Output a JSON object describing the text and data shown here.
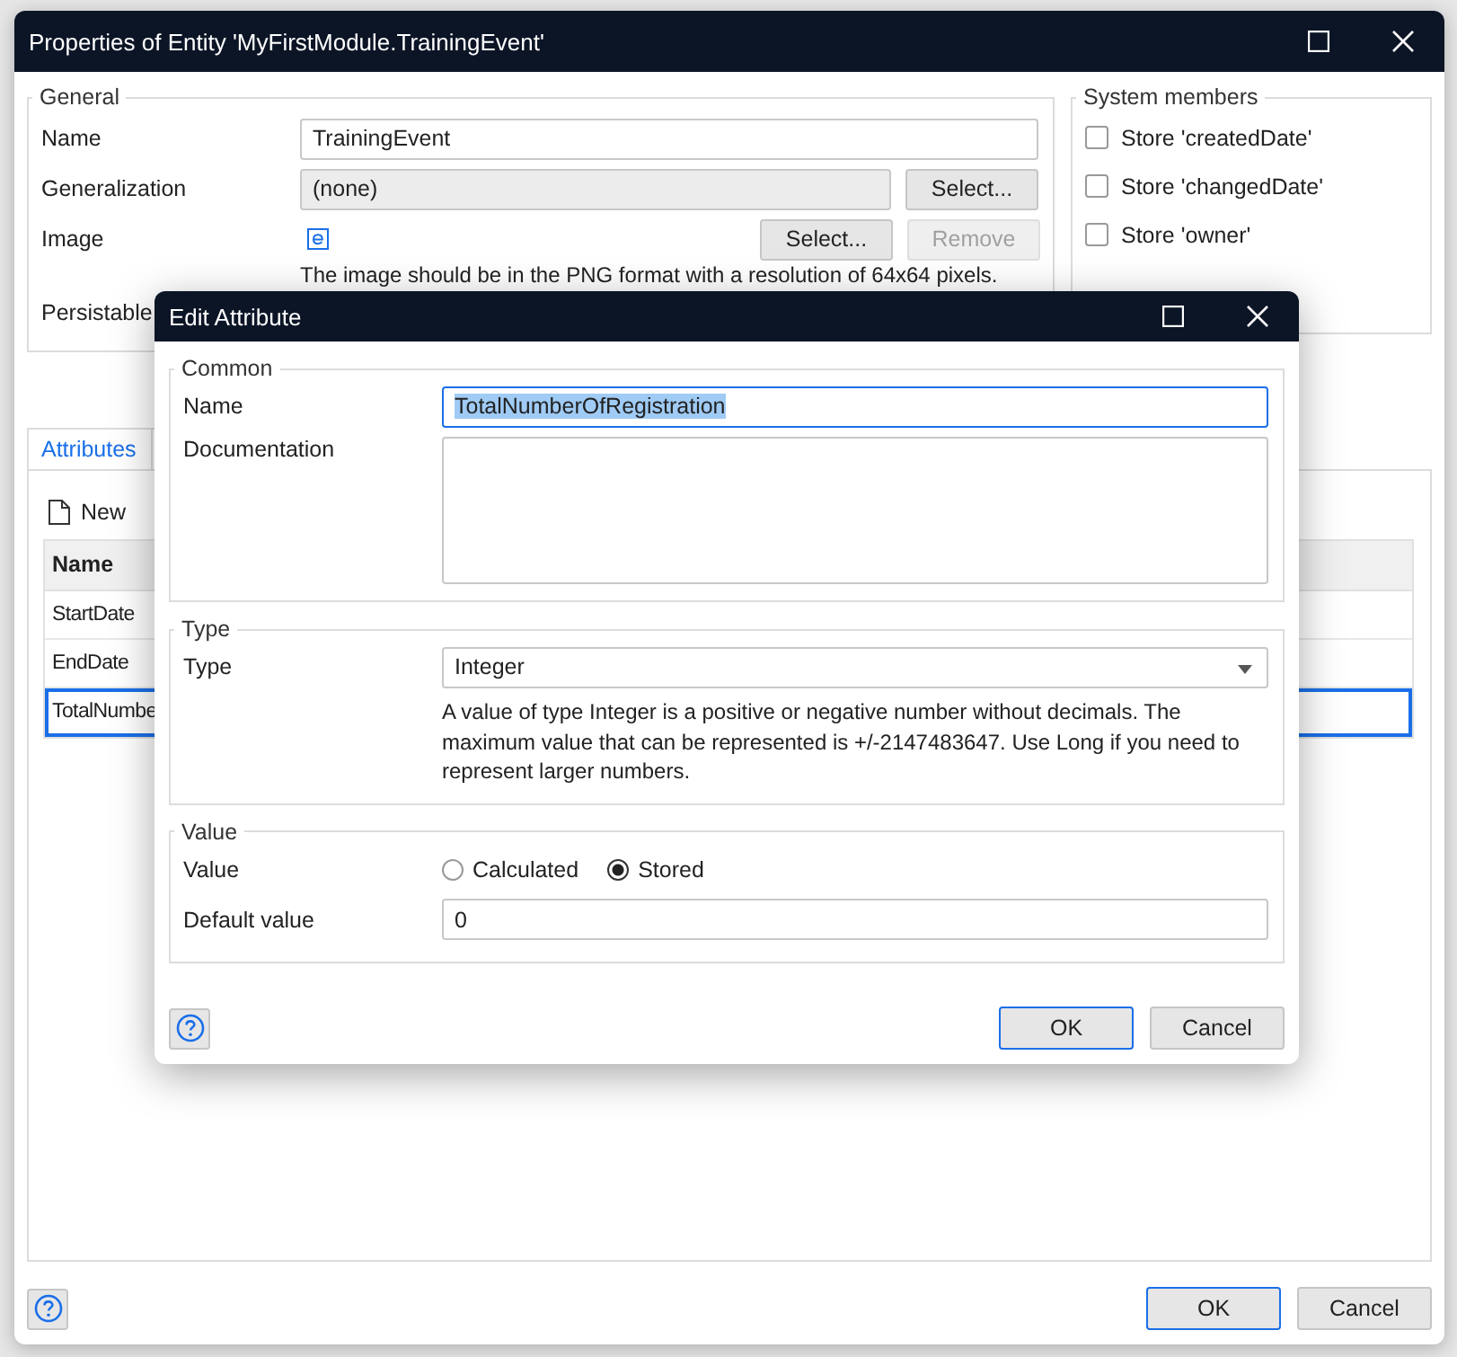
{
  "window": {
    "title": "Properties of Entity 'MyFirstModule.TrainingEvent'",
    "general": {
      "legend": "General",
      "name_field": {
        "label": "Name",
        "value": "TrainingEvent"
      },
      "generalization_field": {
        "label": "Generalization",
        "value": "(none)",
        "button": "Select..."
      },
      "image_field": {
        "label": "Image",
        "buttons": [
          {
            "label": "Select...",
            "disabled": false
          },
          {
            "label": "Remove",
            "disabled": true
          }
        ],
        "note": "The image should be in the PNG format with a resolution of 64x64 pixels."
      },
      "persistable_label": "Persistable"
    },
    "system_members": {
      "legend": "System members",
      "items": [
        {
          "label": "Store 'createdDate'",
          "checked": false
        },
        {
          "label": "Store 'changedDate'",
          "checked": false
        },
        {
          "label": "Store 'owner'",
          "checked": false
        }
      ]
    },
    "tabs": [
      {
        "label": "Attributes",
        "selected": true
      }
    ],
    "new_button": "New",
    "table": {
      "columns": [
        "Name"
      ],
      "rows": [
        {
          "name": "StartDate",
          "selected": false
        },
        {
          "name": "EndDate",
          "selected": false
        },
        {
          "name": "TotalNumbe",
          "selected": true
        }
      ]
    },
    "buttons": [
      {
        "label": "OK",
        "default": true
      },
      {
        "label": "Cancel",
        "default": false
      }
    ]
  },
  "dialog": {
    "title": "Edit Attribute",
    "common": {
      "legend": "Common",
      "name_label": "Name",
      "name_value": "TotalNumberOfRegistration",
      "name_text_selected": true,
      "documentation_label": "Documentation"
    },
    "type": {
      "legend": "Type",
      "label": "Type",
      "value": "Integer",
      "description": "A value of type Integer is a positive or negative number without decimals. The maximum value that can be represented is +/-2147483647. Use Long if you need to represent larger numbers."
    },
    "value": {
      "legend": "Value",
      "label": "Value",
      "options": [
        {
          "label": "Calculated",
          "selected": false
        },
        {
          "label": "Stored",
          "selected": true
        }
      ],
      "default_label": "Default value",
      "default_value": "0"
    },
    "buttons": [
      {
        "label": "OK",
        "default": true
      },
      {
        "label": "Cancel",
        "default": false
      }
    ]
  }
}
